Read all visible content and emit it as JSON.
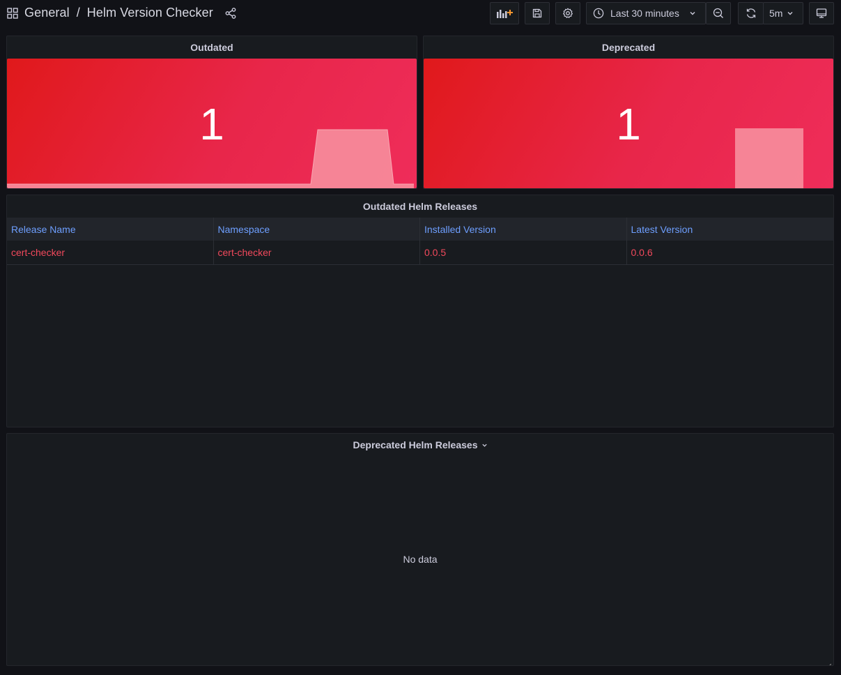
{
  "breadcrumb": {
    "folder": "General",
    "separator": "/",
    "dashboard": "Helm Version Checker"
  },
  "toolbar": {
    "time_range": "Last 30 minutes",
    "refresh_interval": "5m"
  },
  "icons": {
    "grid": "dashboards-grid-icon",
    "share": "share-icon",
    "add_panel": "add-panel-icon",
    "save": "save-icon",
    "settings": "gear-icon",
    "clock": "clock-icon",
    "zoom_out": "zoom-out-icon",
    "refresh": "refresh-icon",
    "tv": "tv-mode-icon"
  },
  "stats": [
    {
      "title": "Outdated",
      "value": "1"
    },
    {
      "title": "Deprecated",
      "value": "1"
    }
  ],
  "outdated_table": {
    "title": "Outdated Helm Releases",
    "columns": [
      "Release Name",
      "Namespace",
      "Installed Version",
      "Latest Version"
    ],
    "rows": [
      [
        "cert-checker",
        "cert-checker",
        "0.0.5",
        "0.0.6"
      ]
    ]
  },
  "deprecated_table": {
    "title": "Deprecated Helm Releases",
    "empty_text": "No data"
  },
  "colors": {
    "background": "#111217",
    "panel": "#181b1f",
    "stat_red": "#e0191b",
    "header_link_blue": "#6e9fff",
    "cell_red": "#f2495c",
    "accent_orange": "#ff9830"
  }
}
